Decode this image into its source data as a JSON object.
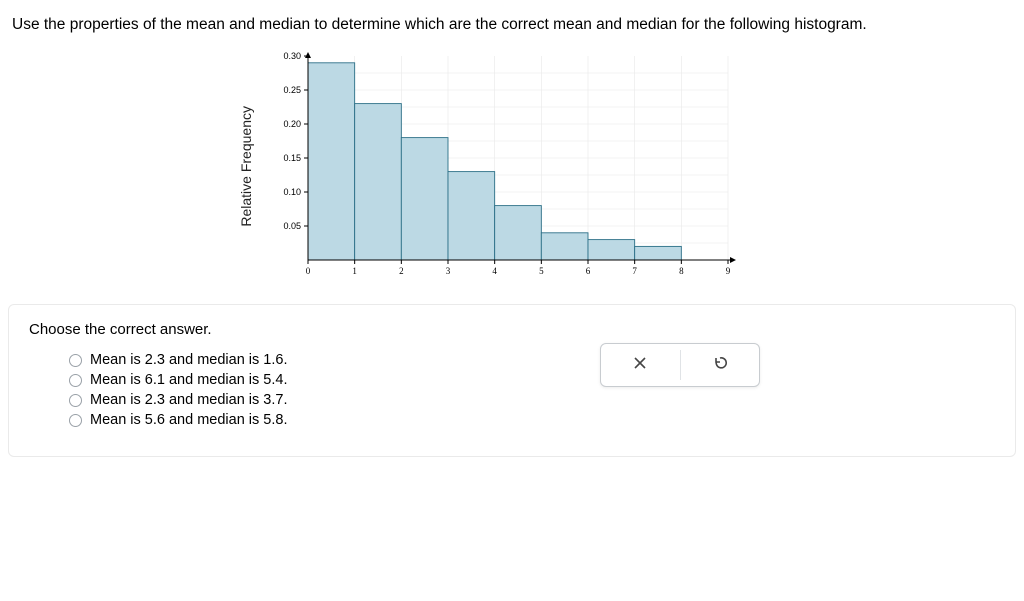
{
  "question": "Use the properties of the mean and median to determine which are the correct mean and median for the following histogram.",
  "y_axis_label": "Relative Frequency",
  "answer_prompt": "Choose the correct answer.",
  "options": [
    "Mean is 2.3 and median is 1.6.",
    "Mean is 6.1 and median is 5.4.",
    "Mean is 2.3 and median is 3.7.",
    "Mean is 5.6 and median is 5.8."
  ],
  "chart_data": {
    "type": "bar",
    "xlabel": "",
    "ylabel": "Relative Frequency",
    "x_ticks": [
      0,
      1,
      2,
      3,
      4,
      5,
      6,
      7,
      8,
      9
    ],
    "y_ticks": [
      0.05,
      0.1,
      0.15,
      0.2,
      0.25,
      0.3
    ],
    "ylim": [
      0,
      0.3
    ],
    "bins": [
      {
        "from": 0,
        "to": 1,
        "value": 0.29
      },
      {
        "from": 1,
        "to": 2,
        "value": 0.23
      },
      {
        "from": 2,
        "to": 3,
        "value": 0.18
      },
      {
        "from": 3,
        "to": 4,
        "value": 0.13
      },
      {
        "from": 4,
        "to": 5,
        "value": 0.08
      },
      {
        "from": 5,
        "to": 6,
        "value": 0.04
      },
      {
        "from": 6,
        "to": 7,
        "value": 0.03
      },
      {
        "from": 7,
        "to": 8,
        "value": 0.02
      }
    ]
  }
}
